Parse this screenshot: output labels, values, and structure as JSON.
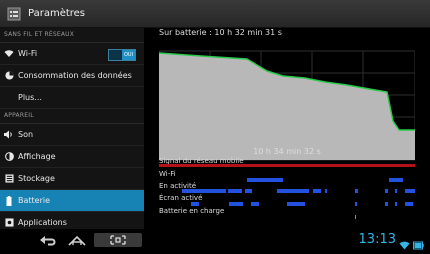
{
  "window": {
    "title": "Paramètres"
  },
  "sidebar": {
    "section_wireless": "SANS FIL ET RÉSEAUX",
    "wifi": {
      "label": "Wi-Fi",
      "toggle": "OUI"
    },
    "data_usage": "Consommation des données",
    "more": "Plus...",
    "section_device": "APPAREIL",
    "sound": "Son",
    "display": "Affichage",
    "storage": "Stockage",
    "battery": "Batterie",
    "apps": "Applications"
  },
  "battery": {
    "on_battery_label": "Sur batterie : 10 h 32 min 31 s",
    "duration_label": "10 h 34 min 32 s",
    "rows": {
      "signal": "Signal du réseau mobile",
      "wifi": "Wi-Fi",
      "active": "En activité",
      "screen": "Écran activé",
      "charging": "Batterie en charge"
    }
  },
  "status": {
    "time": "13:13"
  },
  "colors": {
    "accent": "#33b5e5",
    "selected": "#1783b5",
    "graph_fill": "#b8b8b8",
    "graph_line": "#29c94a",
    "signal_bar": "#b3121b",
    "activity": "#2452e0"
  }
}
